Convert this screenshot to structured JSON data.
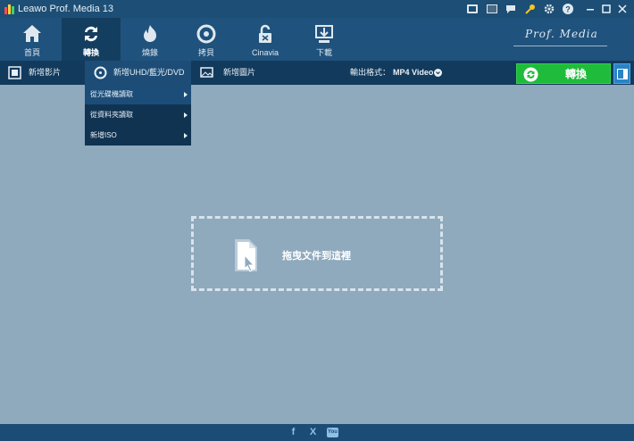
{
  "window": {
    "title": "Leawo Prof. Media 13"
  },
  "titlebar_icons": [
    "shop-icon",
    "screen-record-icon",
    "chat-icon",
    "key-icon",
    "settings-icon",
    "help-icon",
    "minimize-icon",
    "maximize-icon",
    "close-icon"
  ],
  "toolbar": {
    "items": [
      {
        "label": "首頁",
        "icon": "home-icon"
      },
      {
        "label": "轉換",
        "icon": "convert-icon",
        "active": true
      },
      {
        "label": "燒錄",
        "icon": "burn-icon"
      },
      {
        "label": "拷貝",
        "icon": "copy-disc-icon"
      },
      {
        "label": "Cinavia",
        "icon": "cinavia-unlock-icon"
      },
      {
        "label": "下載",
        "icon": "download-icon"
      }
    ],
    "brand": "Prof. Media"
  },
  "actionbar": {
    "add_video": "新增影片",
    "add_uhd": "新增UHD/藍光/DVD",
    "add_photo": "新增圖片",
    "format_label": "輸出格式：",
    "format_value": "MP4 Video",
    "convert_label": "轉換"
  },
  "dropdown": {
    "items": [
      {
        "label": "從光碟機讀取",
        "highlighted": true
      },
      {
        "label": "從資料夾讀取",
        "highlighted": false
      },
      {
        "label": "新增ISO",
        "highlighted": false
      }
    ]
  },
  "dropzone": {
    "label": "拖曳文件到這裡"
  },
  "footer": {
    "social": [
      "f",
      "X",
      "You"
    ]
  },
  "colors": {
    "titlebar": "#1d4e75",
    "toolbar": "#1f527d",
    "actionbar": "#123a5c",
    "canvas": "#8fa9bd",
    "convert": "#1fbb3a",
    "accent": "#2a83c5"
  }
}
